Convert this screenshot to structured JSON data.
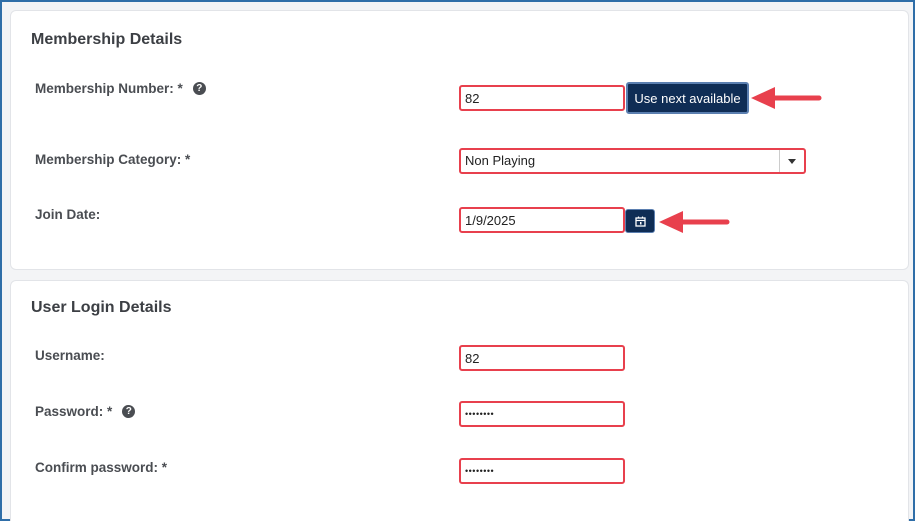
{
  "membership": {
    "heading": "Membership Details",
    "number_label": "Membership Number: *",
    "number_value": "82",
    "use_next_label": "Use next available",
    "category_label": "Membership Category: *",
    "category_value": "Non Playing",
    "join_date_label": "Join Date:",
    "join_date_value": "1/9/2025"
  },
  "login": {
    "heading": "User Login Details",
    "username_label": "Username:",
    "username_value": "82",
    "password_label": "Password: *",
    "password_value": "••••••••",
    "confirm_label": "Confirm password: *",
    "confirm_value": "••••••••"
  },
  "colors": {
    "highlight": "#e8404d",
    "button": "#0f2d55",
    "arrow": "#e8404d"
  },
  "icons": {
    "help": "question-circle-icon",
    "calendar": "calendar-icon",
    "dropdown": "chevron-down-icon"
  }
}
